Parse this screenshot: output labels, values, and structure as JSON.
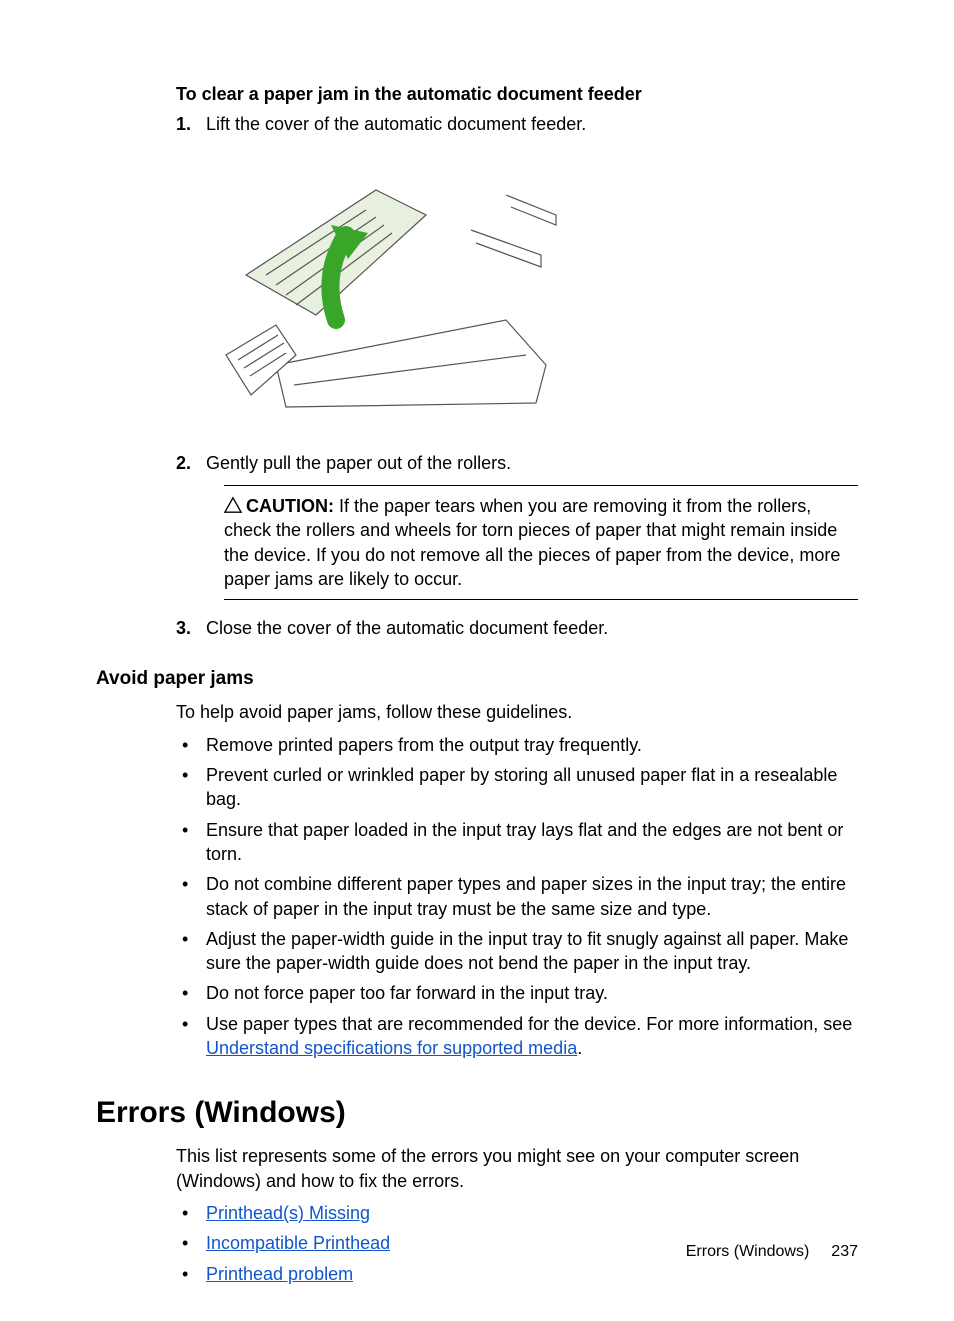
{
  "section1": {
    "title": "To clear a paper jam in the automatic document feeder",
    "steps": {
      "s1": {
        "num": "1.",
        "text": "Lift the cover of the automatic document feeder."
      },
      "s2": {
        "num": "2.",
        "text": "Gently pull the paper out of the rollers."
      },
      "s3": {
        "num": "3.",
        "text": "Close the cover of the automatic document feeder."
      }
    },
    "caution": {
      "label": "CAUTION:",
      "text": "If the paper tears when you are removing it from the rollers, check the rollers and wheels for torn pieces of paper that might remain inside the device. If you do not remove all the pieces of paper from the device, more paper jams are likely to occur."
    }
  },
  "section2": {
    "heading": "Avoid paper jams",
    "intro": "To help avoid paper jams, follow these guidelines.",
    "bullets": {
      "b1": "Remove printed papers from the output tray frequently.",
      "b2": "Prevent curled or wrinkled paper by storing all unused paper flat in a resealable bag.",
      "b3": "Ensure that paper loaded in the input tray lays flat and the edges are not bent or torn.",
      "b4": "Do not combine different paper types and paper sizes in the input tray; the entire stack of paper in the input tray must be the same size and type.",
      "b5": "Adjust the paper-width guide in the input tray to fit snugly against all paper. Make sure the paper-width guide does not bend the paper in the input tray.",
      "b6": "Do not force paper too far forward in the input tray.",
      "b7_pre": "Use paper types that are recommended for the device. For more information, see ",
      "b7_link": "Understand specifications for supported media",
      "b7_post": "."
    }
  },
  "section3": {
    "heading": "Errors (Windows)",
    "intro": "This list represents some of the errors you might see on your computer screen (Windows) and how to fix the errors.",
    "links": {
      "l1": "Printhead(s) Missing",
      "l2": "Incompatible Printhead",
      "l3": "Printhead problem"
    }
  },
  "footer": {
    "label": "Errors (Windows)",
    "page": "237"
  }
}
